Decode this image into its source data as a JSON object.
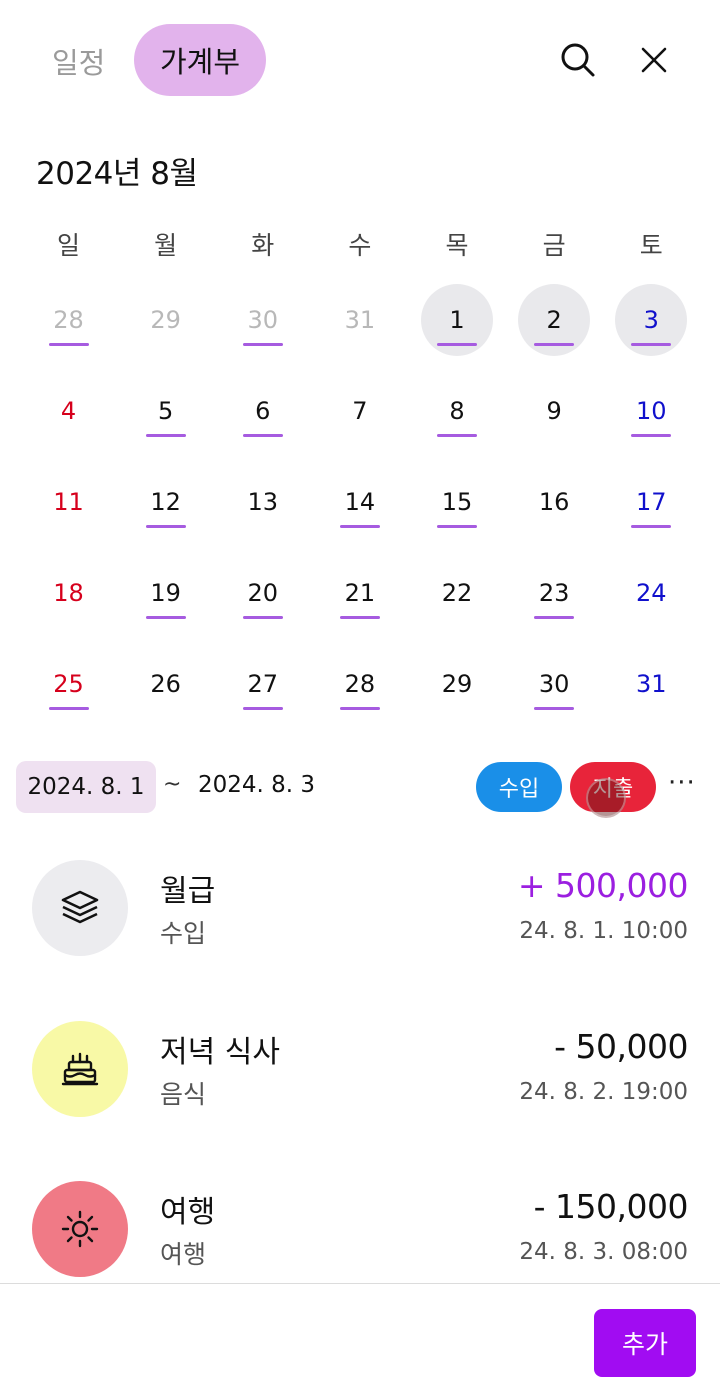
{
  "header": {
    "tab_schedule": "일정",
    "tab_budget": "가계부",
    "search_icon": "search-icon",
    "close_icon": "close-icon"
  },
  "calendar": {
    "month_title": "2024년 8월",
    "weekdays": [
      "일",
      "월",
      "화",
      "수",
      "목",
      "금",
      "토"
    ],
    "weeks": [
      [
        {
          "d": "28",
          "type": "other",
          "line": true
        },
        {
          "d": "29",
          "type": "other",
          "line": false
        },
        {
          "d": "30",
          "type": "other",
          "line": true
        },
        {
          "d": "31",
          "type": "other",
          "line": false
        },
        {
          "d": "1",
          "type": "norm",
          "line": true,
          "selected": true
        },
        {
          "d": "2",
          "type": "norm",
          "line": true,
          "selected": true
        },
        {
          "d": "3",
          "type": "sat",
          "line": true,
          "selected": true
        }
      ],
      [
        {
          "d": "4",
          "type": "sun",
          "line": false
        },
        {
          "d": "5",
          "type": "norm",
          "line": true
        },
        {
          "d": "6",
          "type": "norm",
          "line": true
        },
        {
          "d": "7",
          "type": "norm",
          "line": false
        },
        {
          "d": "8",
          "type": "norm",
          "line": true
        },
        {
          "d": "9",
          "type": "norm",
          "line": false
        },
        {
          "d": "10",
          "type": "sat",
          "line": true
        }
      ],
      [
        {
          "d": "11",
          "type": "sun",
          "line": false
        },
        {
          "d": "12",
          "type": "norm",
          "line": true
        },
        {
          "d": "13",
          "type": "norm",
          "line": false
        },
        {
          "d": "14",
          "type": "norm",
          "line": true
        },
        {
          "d": "15",
          "type": "norm",
          "line": true
        },
        {
          "d": "16",
          "type": "norm",
          "line": false
        },
        {
          "d": "17",
          "type": "sat",
          "line": true
        }
      ],
      [
        {
          "d": "18",
          "type": "sun",
          "line": false
        },
        {
          "d": "19",
          "type": "norm",
          "line": true
        },
        {
          "d": "20",
          "type": "norm",
          "line": true
        },
        {
          "d": "21",
          "type": "norm",
          "line": true
        },
        {
          "d": "22",
          "type": "norm",
          "line": false
        },
        {
          "d": "23",
          "type": "norm",
          "line": true
        },
        {
          "d": "24",
          "type": "sat",
          "line": false
        }
      ],
      [
        {
          "d": "25",
          "type": "sun",
          "line": true
        },
        {
          "d": "26",
          "type": "norm",
          "line": false
        },
        {
          "d": "27",
          "type": "norm",
          "line": true
        },
        {
          "d": "28",
          "type": "norm",
          "line": true
        },
        {
          "d": "29",
          "type": "norm",
          "line": false
        },
        {
          "d": "30",
          "type": "norm",
          "line": true
        },
        {
          "d": "31",
          "type": "sat",
          "line": false
        }
      ]
    ]
  },
  "range": {
    "start": "2024. 8. 1",
    "tilde": "~",
    "end": "2024. 8. 3"
  },
  "filters": {
    "income": "수입",
    "expense": "지출",
    "more": "···"
  },
  "transactions": [
    {
      "title": "월급",
      "category": "수입",
      "amount": "+ 500,000",
      "date": "24. 8. 1. 10:00",
      "kind": "income",
      "icon": "layers-icon",
      "icon_bg": "#ececef"
    },
    {
      "title": "저녁 식사",
      "category": "음식",
      "amount": "- 50,000",
      "date": "24. 8. 2. 19:00",
      "kind": "expense",
      "icon": "cake-icon",
      "icon_bg": "#f8f9a6"
    },
    {
      "title": "여행",
      "category": "여행",
      "amount": "- 150,000",
      "date": "24. 8. 3. 08:00",
      "kind": "expense",
      "icon": "sun-icon",
      "icon_bg": "#f07a86"
    }
  ],
  "footer": {
    "add_label": "추가"
  },
  "colors": {
    "accent": "#a10cf2",
    "selected_tab": "#e2b3ec",
    "income_chip": "#1a8fe8",
    "expense_chip": "#e8243a",
    "underline": "#a65be0"
  }
}
